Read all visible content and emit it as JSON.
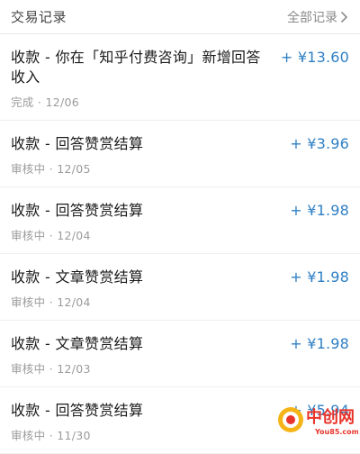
{
  "header": {
    "title": "交易记录",
    "all_records_label": "全部记录"
  },
  "transactions": [
    {
      "title": "收款 - 你在「知乎付费咨询」新增回答收入",
      "status": "完成",
      "date": "12/06",
      "amount": "+ ¥13.60"
    },
    {
      "title": "收款 - 回答赞赏结算",
      "status": "审核中",
      "date": "12/05",
      "amount": "+ ¥3.96"
    },
    {
      "title": "收款 - 回答赞赏结算",
      "status": "审核中",
      "date": "12/04",
      "amount": "+ ¥1.98"
    },
    {
      "title": "收款 - 文章赞赏结算",
      "status": "审核中",
      "date": "12/04",
      "amount": "+ ¥1.98"
    },
    {
      "title": "收款 - 文章赞赏结算",
      "status": "审核中",
      "date": "12/03",
      "amount": "+ ¥1.98"
    },
    {
      "title": "收款 - 回答赞赏结算",
      "status": "审核中",
      "date": "11/30",
      "amount": "+ ¥5.94"
    }
  ],
  "meta_separator": " · ",
  "watermark": {
    "text": "中创网",
    "subtext": "You85.com"
  },
  "colors": {
    "amount": "#2e7fc4",
    "watermark_red": "#e8342b",
    "watermark_yellow": "#f5b417"
  }
}
